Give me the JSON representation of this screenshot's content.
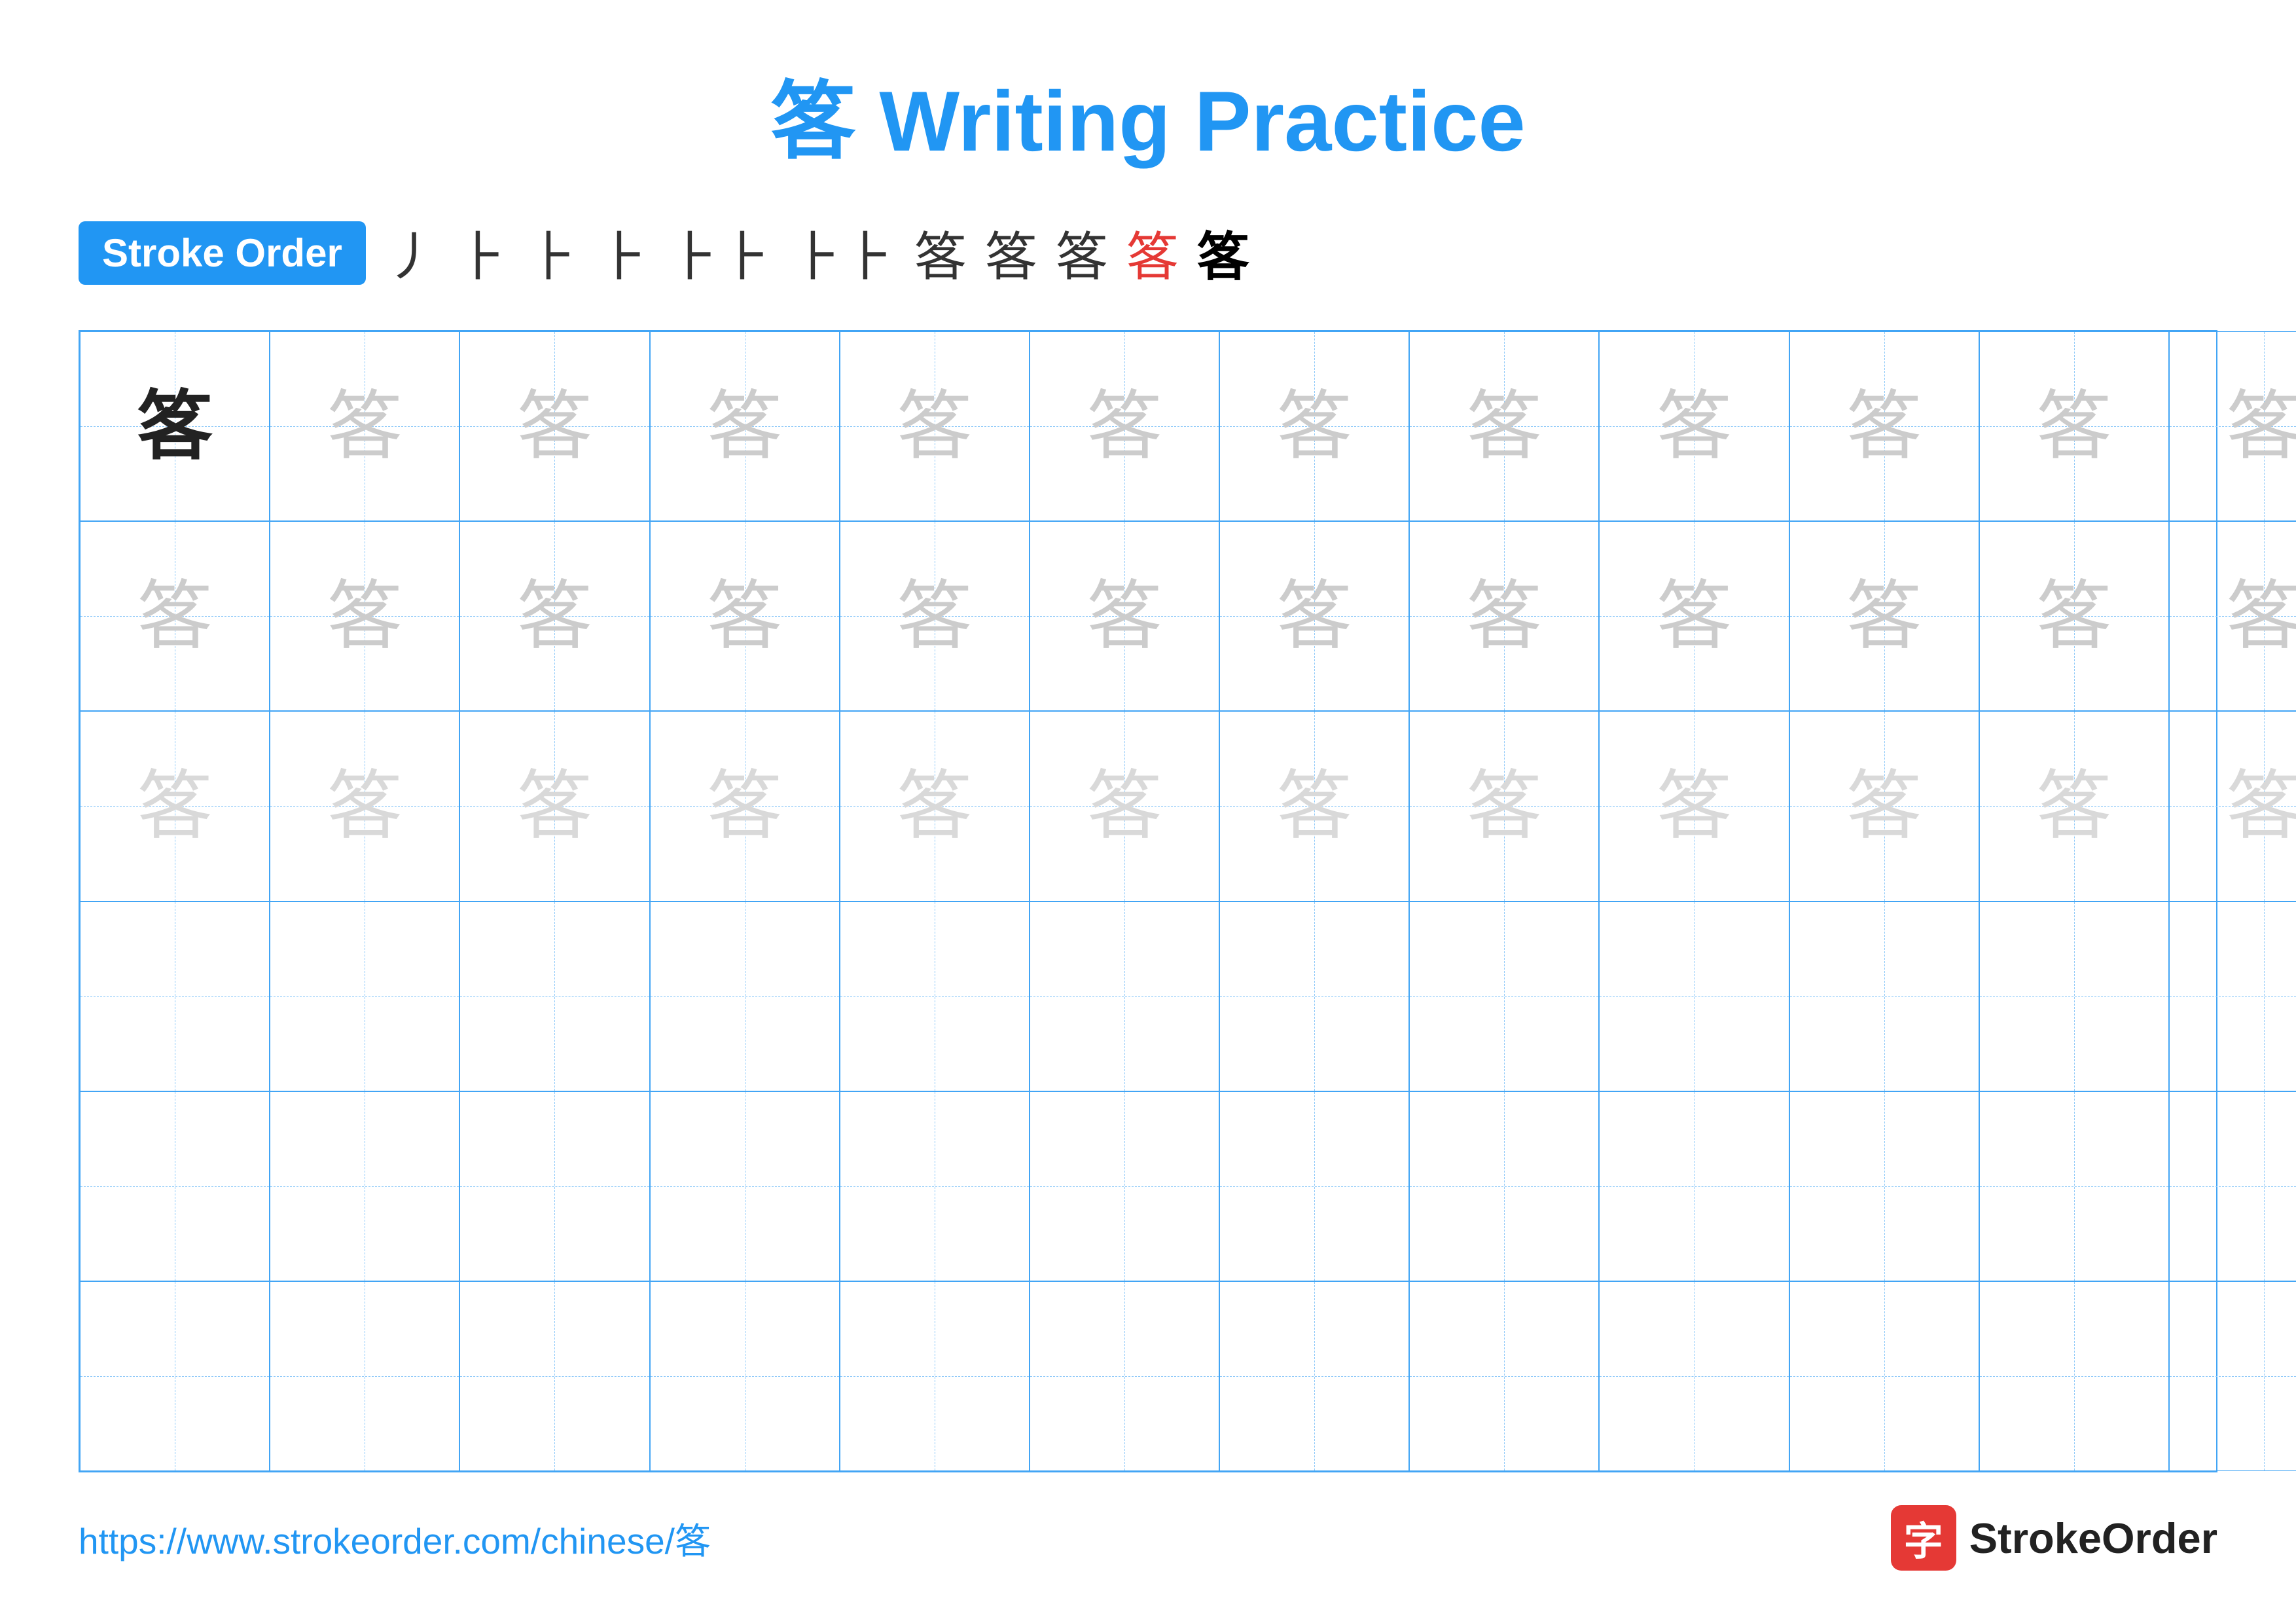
{
  "title": "笿 Writing Practice",
  "stroke_order_badge": "Stroke Order",
  "stroke_steps": [
    "丿",
    "𠄌",
    "𠄎",
    "𠄏",
    "𠄐",
    "𠄑",
    "笿",
    "笿",
    "笿",
    "笿",
    "笿"
  ],
  "stroke_steps_display": [
    "丿",
    "⺊",
    "𠂉",
    "㇇",
    "⺊⺊",
    "⺊⺊⺊",
    "笿",
    "笿",
    "笿",
    "笿",
    "笿"
  ],
  "char": "笿",
  "rows": 6,
  "cols": 13,
  "footer_url": "https://www.strokeorder.com/chinese/笿",
  "footer_logo_text": "StrokeOrder",
  "logo_char": "字"
}
